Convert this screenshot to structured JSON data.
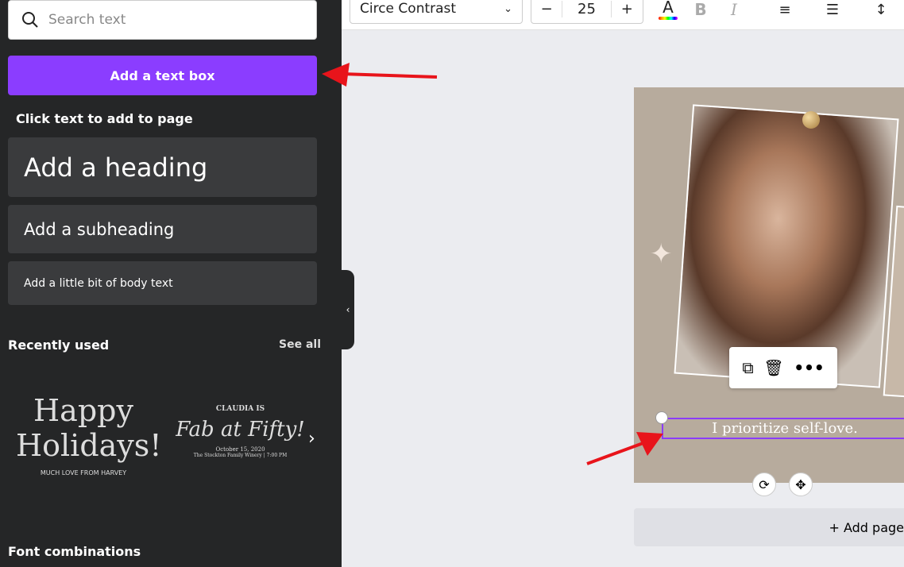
{
  "sidebar": {
    "search_placeholder": "Search text",
    "add_text_box": "Add a text box",
    "click_text_label": "Click text to add to page",
    "heading": "Add a heading",
    "subheading": "Add a subheading",
    "body": "Add a little bit of body text",
    "recently_used": "Recently used",
    "see_all": "See all",
    "font_combinations": "Font combinations",
    "templates": [
      {
        "line1": "Happy",
        "line2": "Holidays!",
        "line3": "MUCH LOVE FROM HARVEY"
      },
      {
        "line1": "CLAUDIA IS",
        "line2": "Fab at Fifty!",
        "line3": "October 15, 2020",
        "line4": "The Stockton Family Winery | 7:00 PM"
      }
    ]
  },
  "toolbar": {
    "font": "Circe Contrast",
    "font_size": "25",
    "minus": "−",
    "plus": "+"
  },
  "canvas": {
    "selected_text": "I prioritize self-love.",
    "add_page": "+ Add page",
    "accent": "#8b3dff"
  }
}
